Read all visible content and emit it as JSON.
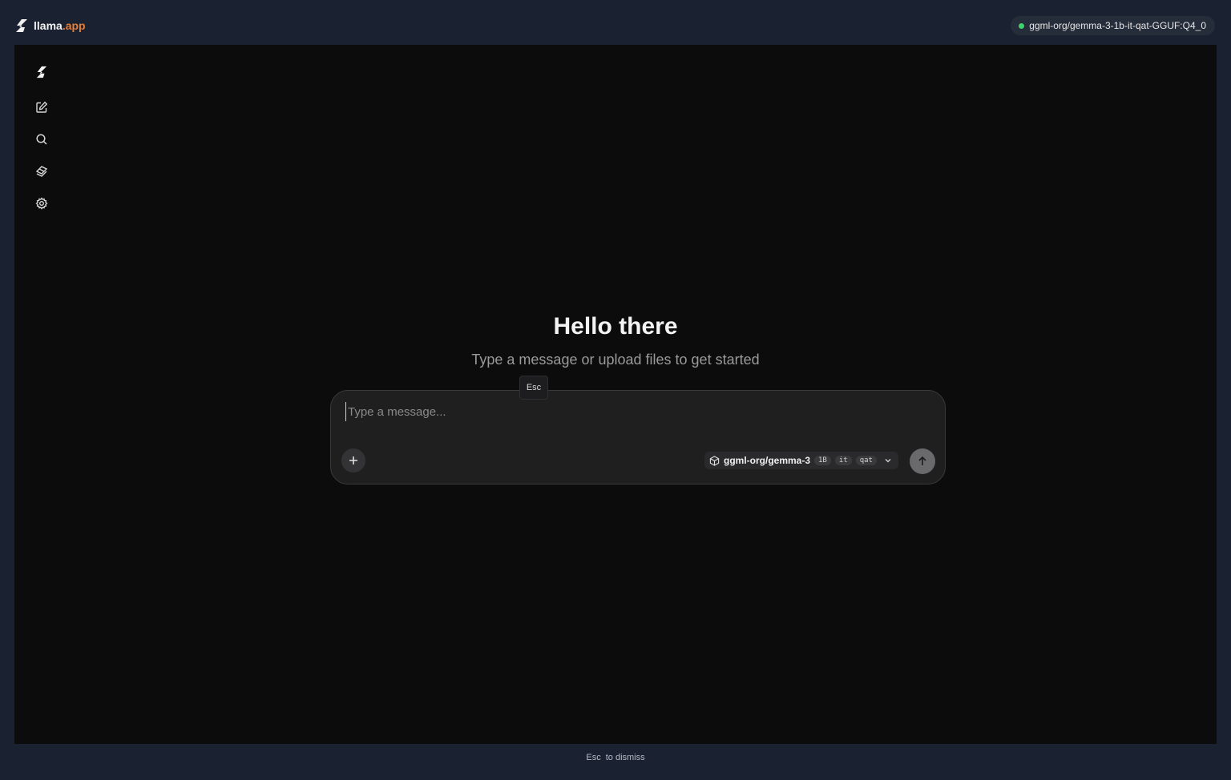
{
  "app": {
    "name": "llama",
    "name_ext": ".app"
  },
  "header": {
    "model_status": "ggml-org/gemma-3-1b-it-qat-GGUF:Q4_0",
    "status_color": "#3fd26a"
  },
  "sidebar": {
    "items": [
      {
        "name": "logo-icon"
      },
      {
        "name": "new-chat-icon"
      },
      {
        "name": "search-icon"
      },
      {
        "name": "layers-icon"
      },
      {
        "name": "settings-icon"
      }
    ]
  },
  "hero": {
    "title": "Hello there",
    "subtitle": "Type a message or upload files to get started"
  },
  "tooltip": {
    "label": "Esc"
  },
  "composer": {
    "placeholder": "Type a message...",
    "model_name": "ggml-org/gemma-3",
    "model_tags": [
      "1B",
      "it",
      "qat"
    ]
  },
  "footer": {
    "key": "Esc",
    "text": "to dismiss"
  },
  "colors": {
    "accent": "#e67e3a",
    "background": "#0c0c0d",
    "frame": "#1a2130"
  }
}
